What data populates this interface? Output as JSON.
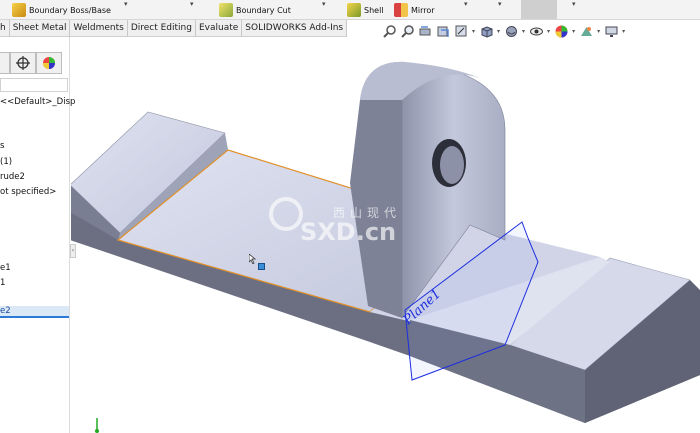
{
  "ribbon": {
    "boundary_boss": "Boundary Boss/Base",
    "boundary_cut": "Boundary Cut",
    "shell": "Shell",
    "mirror": "Mirror"
  },
  "tabs": [
    "h",
    "Sheet Metal",
    "Weldments",
    "Direct Editing",
    "Evaluate",
    "SOLIDWORKS Add-Ins"
  ],
  "view_toolbar": [
    "zoom-to-fit-icon",
    "zoom-area-icon",
    "previous-view-icon",
    "section-view-icon",
    "dynamic-annotation-icon",
    "view-orientation-icon",
    "display-style-icon",
    "hide-show-icon",
    "edit-appearance-icon",
    "apply-scene-icon",
    "view-settings-icon"
  ],
  "feature_tree": {
    "items": [
      {
        "label": "<<Default>_Disp"
      },
      {
        "label": "s"
      },
      {
        "label": "(1)"
      },
      {
        "label": "rude2"
      },
      {
        "label": "ot specified>"
      },
      {
        "label": "e1"
      },
      {
        "label": "1"
      },
      {
        "label": "e2"
      }
    ]
  },
  "viewport": {
    "plane_label": "Plane1",
    "watermark_cn": "西山现代",
    "watermark_en": "SXD.cn"
  },
  "colors": {
    "part_face": "#c9cde0",
    "part_dark": "#6a6e80",
    "selected_edge": "#e0902a",
    "plane_blue": "#1c2ee0"
  }
}
